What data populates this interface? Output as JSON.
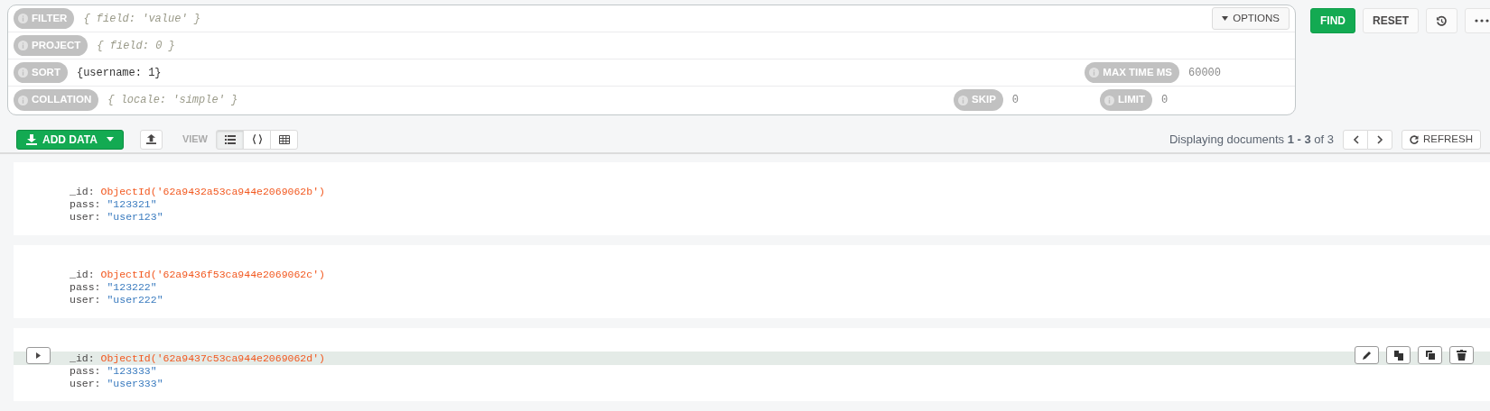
{
  "query_bar": {
    "options_button": "OPTIONS",
    "rows": [
      {
        "label": "FILTER",
        "placeholder": "{ field: 'value' }"
      },
      {
        "label": "PROJECT",
        "placeholder": "{ field: 0 }"
      },
      {
        "label": "SORT",
        "value": "{username: 1}",
        "extra": {
          "label": "MAX TIME MS",
          "placeholder": "60000"
        }
      },
      {
        "label": "COLLATION",
        "placeholder": "{ locale: 'simple' }",
        "extras": [
          {
            "label": "SKIP",
            "placeholder": "0"
          },
          {
            "label": "LIMIT",
            "placeholder": "0"
          }
        ]
      }
    ]
  },
  "actions": {
    "find": "FIND",
    "reset": "RESET"
  },
  "toolbar": {
    "add_data": "ADD DATA",
    "view_label": "VIEW",
    "views": [
      {
        "kind": "list",
        "selected": true
      },
      {
        "kind": "json",
        "selected": false
      },
      {
        "kind": "table",
        "selected": false
      }
    ],
    "count_text": "Displaying documents **1 - 3** of 3",
    "refresh": "REFRESH"
  },
  "documents": [
    {
      "hovered": false,
      "fields": [
        {
          "key": "_id:",
          "value": "ObjectId('62a9432a53ca944e2069062b')",
          "kind": "objectid"
        },
        {
          "key": "pass:",
          "value": "\"123321\"",
          "kind": "string"
        },
        {
          "key": "user:",
          "value": "\"user123\"",
          "kind": "string"
        }
      ]
    },
    {
      "hovered": false,
      "fields": [
        {
          "key": "_id:",
          "value": "ObjectId('62a9436f53ca944e2069062c')",
          "kind": "objectid"
        },
        {
          "key": "pass:",
          "value": "\"123222\"",
          "kind": "string"
        },
        {
          "key": "user:",
          "value": "\"user222\"",
          "kind": "string"
        }
      ]
    },
    {
      "hovered": true,
      "fields": [
        {
          "key": "_id:",
          "value": "ObjectId('62a9437c53ca944e2069062d')",
          "kind": "objectid"
        },
        {
          "key": "pass:",
          "value": "\"123333\"",
          "kind": "string"
        },
        {
          "key": "user:",
          "value": "\"user333\"",
          "kind": "string"
        }
      ]
    }
  ]
}
